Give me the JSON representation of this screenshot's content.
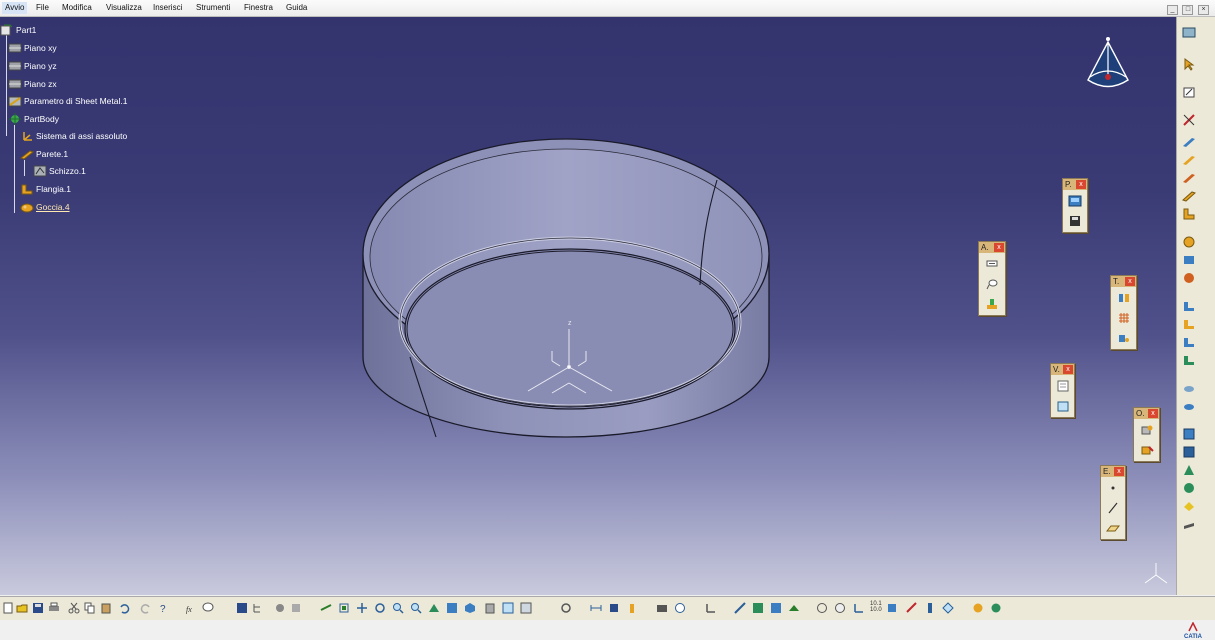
{
  "menu": {
    "items": [
      "Avvio",
      "File",
      "Modifica",
      "Visualizza",
      "Inserisci",
      "Strumenti",
      "Finestra",
      "Guida"
    ]
  },
  "window_controls": [
    "_",
    "□",
    "×"
  ],
  "tree": {
    "root": "Part1",
    "nodes": [
      {
        "label": "Piano xy",
        "icon": "plane-icon"
      },
      {
        "label": "Piano yz",
        "icon": "plane-icon"
      },
      {
        "label": "Piano zx",
        "icon": "plane-icon"
      },
      {
        "label": "Parametro di Sheet Metal.1",
        "icon": "sheetmetal-params-icon"
      },
      {
        "label": "PartBody",
        "icon": "partbody-icon"
      },
      {
        "label": "Sistema di assi assoluto",
        "icon": "axis-system-icon"
      },
      {
        "label": "Parete.1",
        "icon": "wall-icon"
      },
      {
        "label": "Schizzo.1",
        "icon": "sketch-icon"
      },
      {
        "label": "Flangia.1",
        "icon": "flange-icon"
      },
      {
        "label": "Goccia.4",
        "icon": "teardrop-icon"
      }
    ]
  },
  "floating_toolbars": [
    {
      "title": "P.",
      "close": "x",
      "icons": [
        "save-view-icon",
        "store-icon"
      ]
    },
    {
      "title": "A.",
      "close": "x",
      "icons": [
        "annotation-text-icon",
        "annotation-flag-icon",
        "measure-icon"
      ]
    },
    {
      "title": "T.",
      "close": "x",
      "icons": [
        "tool-a-icon",
        "grid-icon",
        "tool-b-icon"
      ]
    },
    {
      "title": "V.",
      "close": "x",
      "icons": [
        "view-sheet-icon",
        "view-box-icon"
      ]
    },
    {
      "title": "O.",
      "close": "x",
      "icons": [
        "operation-a-icon",
        "operation-b-icon"
      ]
    },
    {
      "title": "E.",
      "close": "x",
      "icons": [
        "point-icon",
        "line-icon",
        "plane-icon"
      ]
    }
  ],
  "axis_labels": {
    "z": "z"
  },
  "bottom_toolbar_readout": "10.1\n10.0",
  "logo_text": "CATIA",
  "colors": {
    "viewport_top": "#33336e",
    "viewport_bottom": "#c9cadd",
    "part_body": "#8c8fb6",
    "toolbar_title": "#d8b67a",
    "close_button": "#d9472f"
  }
}
